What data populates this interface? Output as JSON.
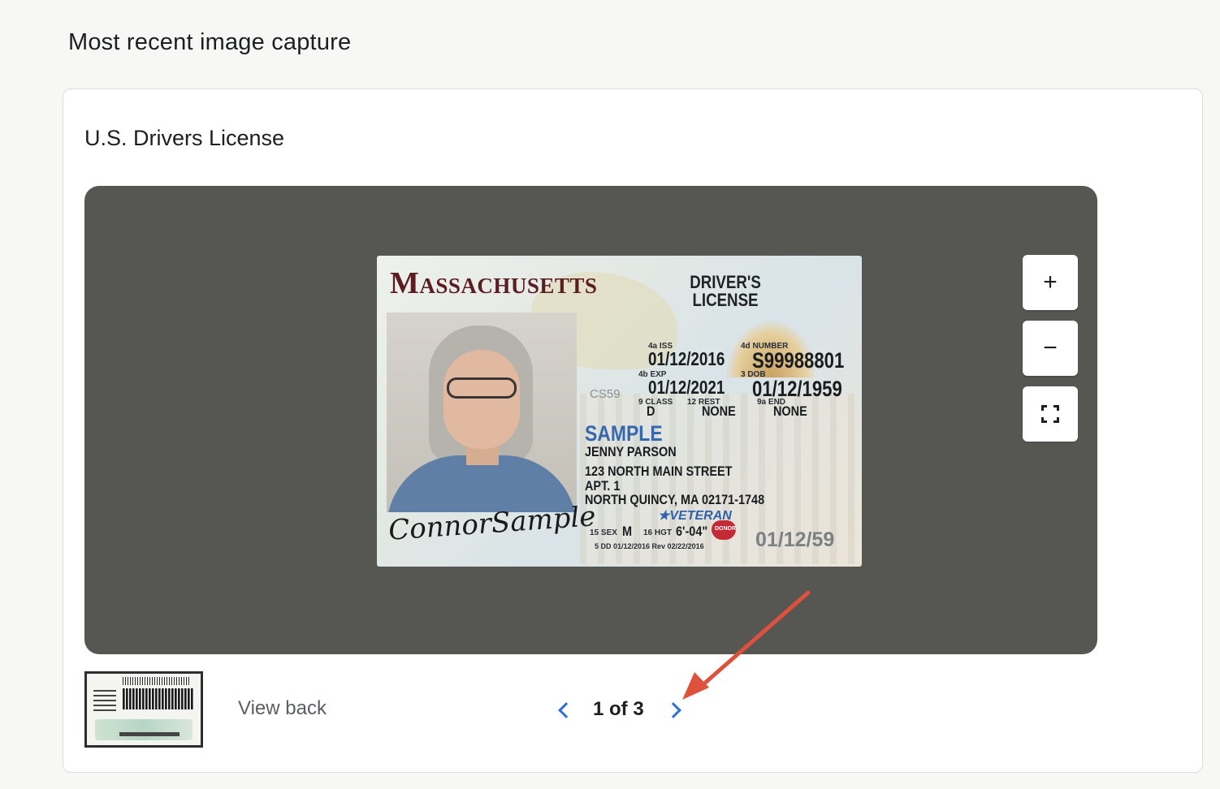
{
  "page": {
    "title": "Most recent image capture"
  },
  "card": {
    "title": "U.S. Drivers License"
  },
  "license": {
    "state": "Massachusetts",
    "type_line1": "DRIVER'S",
    "type_line2": "LICENSE",
    "iss_label": "4a ISS",
    "iss": "01/12/2016",
    "exp_label": "4b EXP",
    "exp": "01/12/2021",
    "number_label": "4d NUMBER",
    "number": "S99988801",
    "dob_label": "3 DOB",
    "dob": "01/12/1959",
    "class_label": "9 CLASS",
    "class": "D",
    "rest_label": "12 REST",
    "rest": "NONE",
    "end_label": "9a END",
    "end": "NONE",
    "cs": "CS59",
    "sample": "SAMPLE",
    "name": "JENNY PARSON",
    "address1": "123 NORTH MAIN STREET",
    "address2": "APT. 1",
    "address3": "NORTH QUINCY, MA 02171-1748",
    "veteran": "★VETERAN",
    "sex_label": "15 SEX",
    "sex": "M",
    "hgt_label": "16 HGT",
    "hgt": "6'-04\"",
    "donor": "DONOR",
    "dd": "5 DD 01/12/2016 Rev 02/22/2016",
    "dob_short": "01/12/59",
    "signature": "ConnorSample"
  },
  "controls": {
    "zoom_in": "+",
    "zoom_out": "−"
  },
  "footer": {
    "view_back": "View back",
    "pager": "1 of 3"
  },
  "colors": {
    "accent": "#2f6fd6",
    "viewer_bg": "#565753",
    "annotation": "#e0513d"
  },
  "icons": [
    "plus-icon",
    "minus-icon",
    "fullscreen-icon",
    "chevron-left-icon",
    "chevron-right-icon",
    "annotation-arrow-icon"
  ]
}
